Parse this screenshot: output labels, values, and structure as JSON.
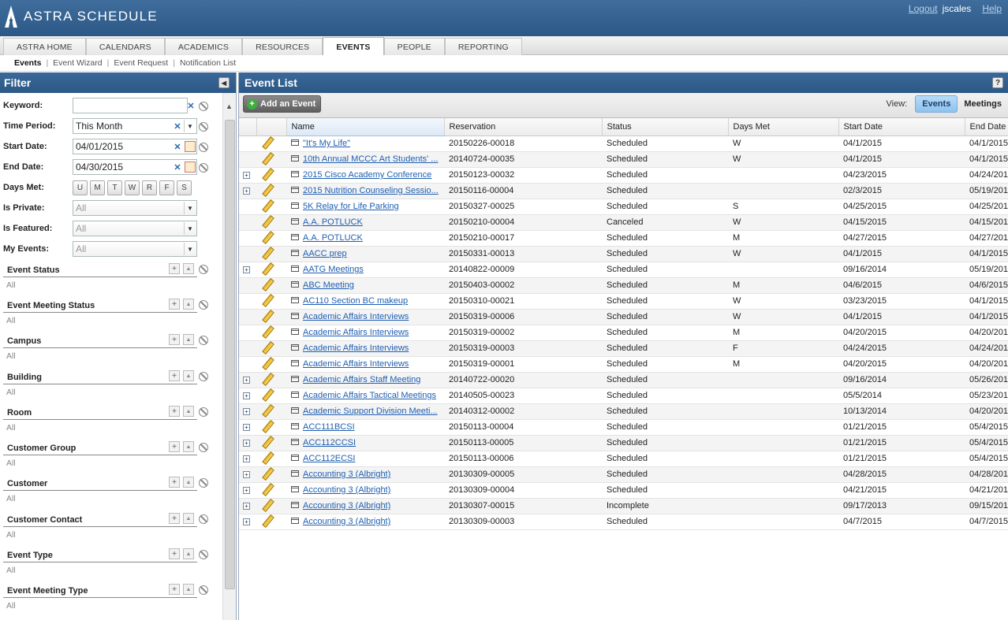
{
  "header": {
    "app_title": "ASTRA SCHEDULE",
    "logout": "Logout",
    "username": "jscales",
    "help": "Help"
  },
  "nav": {
    "tabs": [
      {
        "label": "ASTRA HOME"
      },
      {
        "label": "CALENDARS"
      },
      {
        "label": "ACADEMICS"
      },
      {
        "label": "RESOURCES"
      },
      {
        "label": "EVENTS",
        "active": true
      },
      {
        "label": "PEOPLE"
      },
      {
        "label": "REPORTING"
      }
    ]
  },
  "subnav": {
    "items": [
      "Events",
      "Event Wizard",
      "Event Request",
      "Notification List"
    ]
  },
  "filter": {
    "title": "Filter",
    "keyword": {
      "label": "Keyword:",
      "value": ""
    },
    "time_period": {
      "label": "Time Period:",
      "value": "This Month"
    },
    "start_date": {
      "label": "Start Date:",
      "value": "04/01/2015"
    },
    "end_date": {
      "label": "End Date:",
      "value": "04/30/2015"
    },
    "days_met": {
      "label": "Days Met:",
      "days": [
        "U",
        "M",
        "T",
        "W",
        "R",
        "F",
        "S"
      ]
    },
    "is_private": {
      "label": "Is Private:",
      "value": "All"
    },
    "is_featured": {
      "label": "Is Featured:",
      "value": "All"
    },
    "my_events": {
      "label": "My Events:",
      "value": "All"
    },
    "groups": [
      {
        "label": "Event Status",
        "value": "All"
      },
      {
        "label": "Event Meeting Status",
        "value": "All"
      },
      {
        "label": "Campus",
        "value": "All"
      },
      {
        "label": "Building",
        "value": "All"
      },
      {
        "label": "Room",
        "value": "All"
      },
      {
        "label": "Customer Group",
        "value": "All"
      },
      {
        "label": "Customer",
        "value": "All"
      },
      {
        "label": "Customer Contact",
        "value": "All"
      },
      {
        "label": "Event Type",
        "value": "All"
      },
      {
        "label": "Event Meeting Type",
        "value": "All"
      }
    ]
  },
  "event_list": {
    "title": "Event List",
    "help": "?",
    "add_button": "Add an Event",
    "view_label": "View:",
    "view_options": [
      "Events",
      "Meetings"
    ],
    "columns": [
      "Name",
      "Reservation",
      "Status",
      "Days Met",
      "Start Date",
      "End Date"
    ],
    "rows": [
      {
        "expand": false,
        "name": "\"It's My Life\"",
        "reservation": "20150226-00018",
        "status": "Scheduled",
        "days": "W",
        "start": "04/1/2015",
        "end": "04/1/2015"
      },
      {
        "expand": false,
        "name": "10th Annual MCCC Art Students' ...",
        "reservation": "20140724-00035",
        "status": "Scheduled",
        "days": "W",
        "start": "04/1/2015",
        "end": "04/1/2015"
      },
      {
        "expand": true,
        "name": "2015 Cisco Academy Conference",
        "reservation": "20150123-00032",
        "status": "Scheduled",
        "days": "",
        "start": "04/23/2015",
        "end": "04/24/201"
      },
      {
        "expand": true,
        "name": "2015 Nutrition Counseling Sessio...",
        "reservation": "20150116-00004",
        "status": "Scheduled",
        "days": "",
        "start": "02/3/2015",
        "end": "05/19/201"
      },
      {
        "expand": false,
        "name": "5K Relay for Life Parking",
        "reservation": "20150327-00025",
        "status": "Scheduled",
        "days": "S",
        "start": "04/25/2015",
        "end": "04/25/201"
      },
      {
        "expand": false,
        "name": "A.A. POTLUCK",
        "reservation": "20150210-00004",
        "status": "Canceled",
        "days": "W",
        "start": "04/15/2015",
        "end": "04/15/201"
      },
      {
        "expand": false,
        "name": "A.A. POTLUCK",
        "reservation": "20150210-00017",
        "status": "Scheduled",
        "days": "M",
        "start": "04/27/2015",
        "end": "04/27/201"
      },
      {
        "expand": false,
        "name": "AACC prep",
        "reservation": "20150331-00013",
        "status": "Scheduled",
        "days": "W",
        "start": "04/1/2015",
        "end": "04/1/2015"
      },
      {
        "expand": true,
        "name": "AATG Meetings",
        "reservation": "20140822-00009",
        "status": "Scheduled",
        "days": "",
        "start": "09/16/2014",
        "end": "05/19/201"
      },
      {
        "expand": false,
        "name": "ABC Meeting",
        "reservation": "20150403-00002",
        "status": "Scheduled",
        "days": "M",
        "start": "04/6/2015",
        "end": "04/6/2015"
      },
      {
        "expand": false,
        "name": "AC110 Section BC makeup",
        "reservation": "20150310-00021",
        "status": "Scheduled",
        "days": "W",
        "start": "03/23/2015",
        "end": "04/1/2015"
      },
      {
        "expand": false,
        "name": "Academic Affairs Interviews",
        "reservation": "20150319-00006",
        "status": "Scheduled",
        "days": "W",
        "start": "04/1/2015",
        "end": "04/1/2015"
      },
      {
        "expand": false,
        "name": "Academic Affairs Interviews",
        "reservation": "20150319-00002",
        "status": "Scheduled",
        "days": "M",
        "start": "04/20/2015",
        "end": "04/20/201"
      },
      {
        "expand": false,
        "name": "Academic Affairs Interviews",
        "reservation": "20150319-00003",
        "status": "Scheduled",
        "days": "F",
        "start": "04/24/2015",
        "end": "04/24/201"
      },
      {
        "expand": false,
        "name": "Academic Affairs Interviews",
        "reservation": "20150319-00001",
        "status": "Scheduled",
        "days": "M",
        "start": "04/20/2015",
        "end": "04/20/201"
      },
      {
        "expand": true,
        "name": "Academic Affairs Staff Meeting",
        "reservation": "20140722-00020",
        "status": "Scheduled",
        "days": "",
        "start": "09/16/2014",
        "end": "05/26/201"
      },
      {
        "expand": true,
        "name": "Academic Affairs Tactical Meetings",
        "reservation": "20140505-00023",
        "status": "Scheduled",
        "days": "",
        "start": "05/5/2014",
        "end": "05/23/201"
      },
      {
        "expand": true,
        "name": "Academic Support Division Meeti...",
        "reservation": "20140312-00002",
        "status": "Scheduled",
        "days": "",
        "start": "10/13/2014",
        "end": "04/20/201"
      },
      {
        "expand": true,
        "name": "ACC111BCSI",
        "reservation": "20150113-00004",
        "status": "Scheduled",
        "days": "",
        "start": "01/21/2015",
        "end": "05/4/2015"
      },
      {
        "expand": true,
        "name": "ACC112CCSI",
        "reservation": "20150113-00005",
        "status": "Scheduled",
        "days": "",
        "start": "01/21/2015",
        "end": "05/4/2015"
      },
      {
        "expand": true,
        "name": "ACC112ECSI",
        "reservation": "20150113-00006",
        "status": "Scheduled",
        "days": "",
        "start": "01/21/2015",
        "end": "05/4/2015"
      },
      {
        "expand": true,
        "name": "Accounting 3 (Albright)",
        "reservation": "20130309-00005",
        "status": "Scheduled",
        "days": "",
        "start": "04/28/2015",
        "end": "04/28/201"
      },
      {
        "expand": true,
        "name": "Accounting 3 (Albright)",
        "reservation": "20130309-00004",
        "status": "Scheduled",
        "days": "",
        "start": "04/21/2015",
        "end": "04/21/201"
      },
      {
        "expand": true,
        "name": "Accounting 3 (Albright)",
        "reservation": "20130307-00015",
        "status": "Incomplete",
        "days": "",
        "start": "09/17/2013",
        "end": "09/15/201"
      },
      {
        "expand": true,
        "name": "Accounting 3 (Albright)",
        "reservation": "20130309-00003",
        "status": "Scheduled",
        "days": "",
        "start": "04/7/2015",
        "end": "04/7/2015"
      }
    ]
  }
}
